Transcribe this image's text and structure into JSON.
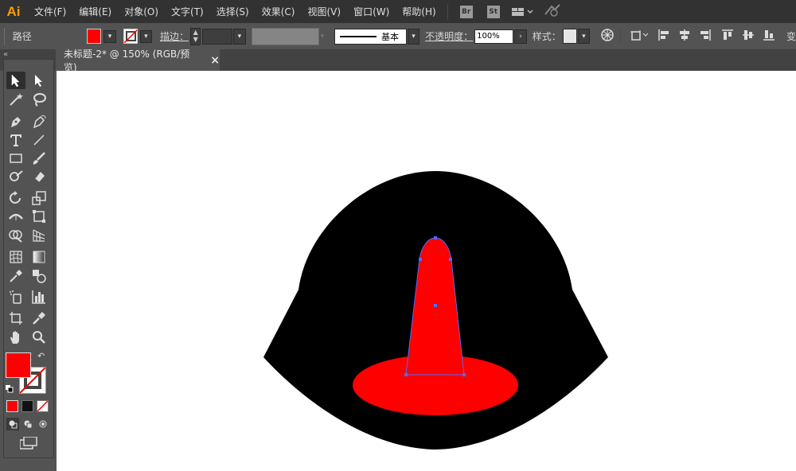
{
  "app": {
    "logo_text": "Ai",
    "brand_color": "#ff9a00"
  },
  "menu": {
    "items": [
      "文件(F)",
      "编辑(E)",
      "对象(O)",
      "文字(T)",
      "选择(S)",
      "效果(C)",
      "视图(V)",
      "窗口(W)",
      "帮助(H)"
    ],
    "bridge_label": "Br",
    "stock_label": "St"
  },
  "control_bar": {
    "selection_label": "路径",
    "fill_color": "#ff0000",
    "stroke_label": "描边：",
    "brush_label": "基本",
    "opacity_label": "不透明度：",
    "opacity_value": "100%",
    "style_label": "样式：",
    "overflow_char": "变"
  },
  "document": {
    "tab_title": "未标题-2* @ 150% (RGB/预览)",
    "close_glyph": "×"
  },
  "toolbox": {
    "fill_color": "#ff0000",
    "stroke_color": "none"
  },
  "artwork": {
    "background_shape_color": "#000000",
    "ellipse_color": "#ff0000",
    "cone_color": "#ff0000",
    "selection_color": "#4f6bff"
  }
}
